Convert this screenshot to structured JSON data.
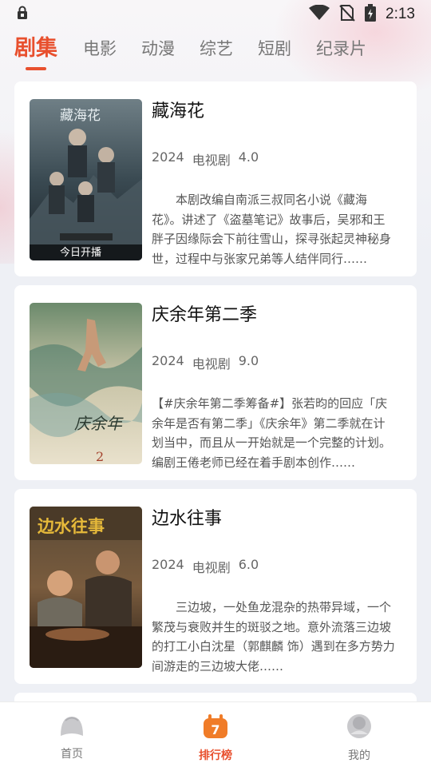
{
  "status_bar": {
    "time": "2:13",
    "icons": [
      "lock-icon",
      "wifi-icon",
      "no-sim-icon",
      "battery-charging-icon"
    ]
  },
  "tabs": [
    {
      "label": "剧集",
      "active": true
    },
    {
      "label": "电影",
      "active": false
    },
    {
      "label": "动漫",
      "active": false
    },
    {
      "label": "综艺",
      "active": false
    },
    {
      "label": "短剧",
      "active": false
    },
    {
      "label": "纪录片",
      "active": false
    }
  ],
  "items": [
    {
      "title": "藏海花",
      "year": "2024",
      "type": "电视剧",
      "score": "4.0",
      "description": "　　本剧改编自南派三叔同名小说《藏海花》。讲述了《盗墓笔记》故事后，吴邪和王胖子因缘际会下前往雪山，探寻张起灵神秘身世，过程中与张家兄弟等人结伴同行……",
      "poster_title": "藏海花",
      "poster_caption": "今日开播"
    },
    {
      "title": "庆余年第二季",
      "year": "2024",
      "type": "电视剧",
      "score": "9.0",
      "description": "【#庆余年第二季筹备#】张若昀的回应「庆余年是否有第二季」《庆余年》第二季就在计划当中，而且从一开始就是一个完整的计划。编剧王倦老师已经在着手剧本创作……",
      "poster_title": "庆余年"
    },
    {
      "title": "边水往事",
      "year": "2024",
      "type": "电视剧",
      "score": "6.0",
      "description": "　　三边坡，一处鱼龙混杂的热带异域，一个繁茂与衰败并生的斑驳之地。意外流落三边坡的打工小白沈星（郭麒麟 饰）遇到在多方势力间游走的三边坡大佬……",
      "poster_title": "边水往事"
    }
  ],
  "bottom_nav": [
    {
      "label": "首页",
      "icon": "home-avatar-icon",
      "active": false
    },
    {
      "label": "排行榜",
      "icon": "ranking-calendar-icon",
      "badge": "7",
      "active": true
    },
    {
      "label": "我的",
      "icon": "profile-avatar-icon",
      "active": false
    }
  ],
  "colors": {
    "accent": "#e8502e",
    "background": "#eef0f5",
    "card": "#ffffff"
  }
}
